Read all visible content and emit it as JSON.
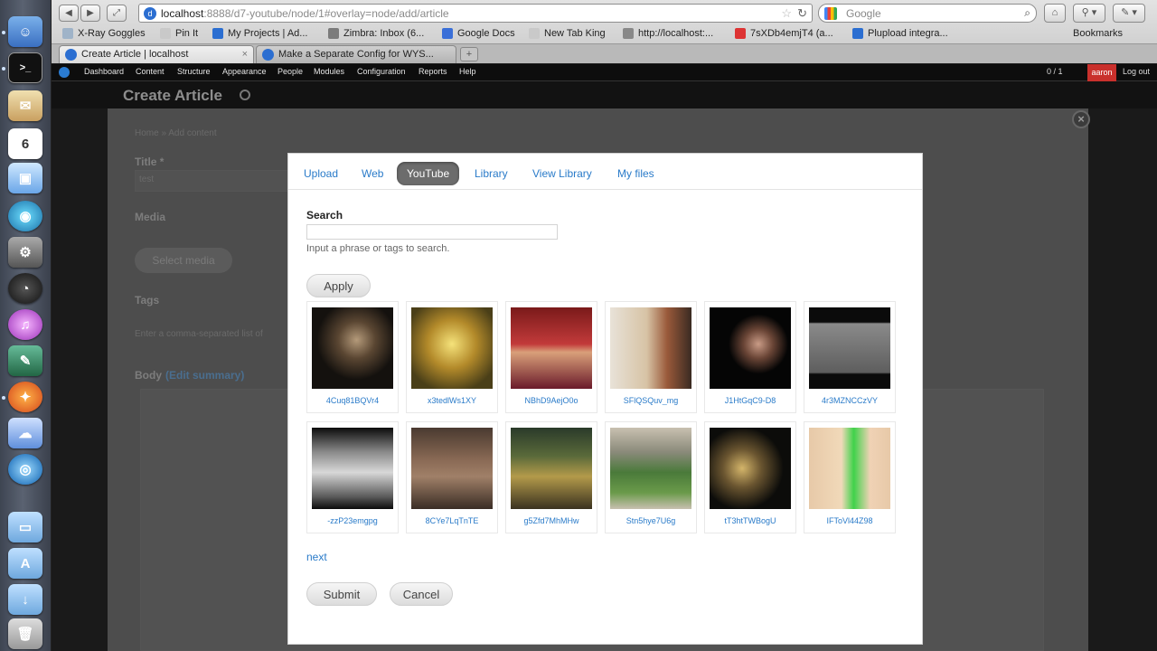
{
  "browser": {
    "url_host": "localhost",
    "url_rest": ":8888/d7-youtube/node/1#overlay=node/add/article",
    "search_placeholder": "Google",
    "bookmarks_label": "Bookmarks",
    "bookmarks": [
      {
        "label": "X-Ray Goggles",
        "color": "#9fb3c8"
      },
      {
        "label": "Pin It",
        "color": "#c9c9c9"
      },
      {
        "label": "My Projects | Ad...",
        "color": "#2b6ed1"
      },
      {
        "label": "Zimbra: Inbox (6...",
        "color": "#7b7b7b"
      },
      {
        "label": "Google Docs",
        "color": "#3a6fd8"
      },
      {
        "label": "New Tab King",
        "color": "#c9c9c9"
      },
      {
        "label": "http://localhost:...",
        "color": "#888888"
      },
      {
        "label": "7sXDb4emjT4 (a...",
        "color": "#d33"
      },
      {
        "label": "Plupload integra...",
        "color": "#2b6ed1"
      }
    ],
    "tabs": [
      {
        "label": "Create Article | localhost",
        "active": true
      },
      {
        "label": "Make a Separate Config for WYS...",
        "active": false
      }
    ]
  },
  "toolbar": {
    "items": [
      "Dashboard",
      "Content",
      "Structure",
      "Appearance",
      "People",
      "Modules",
      "Configuration",
      "Reports",
      "Help"
    ],
    "count": "0 / 1",
    "user": "aaron",
    "logout": "Log out"
  },
  "page": {
    "title": "Create Article",
    "breadcrumb": "Home » Add content",
    "title_field_label": "Title *",
    "title_field_value": "test",
    "media_label": "Media",
    "select_media": "Select media",
    "tags_label": "Tags",
    "tags_help": "Enter a comma-separated list of",
    "body_label": "Body",
    "edit_summary": "(Edit summary)"
  },
  "modal": {
    "tabs": [
      {
        "label": "Upload",
        "active": false
      },
      {
        "label": "Web",
        "active": false
      },
      {
        "label": "YouTube",
        "active": true
      },
      {
        "label": "Library",
        "active": false
      },
      {
        "label": "View Library",
        "active": false
      },
      {
        "label": "My files",
        "active": false
      }
    ],
    "search_label": "Search",
    "search_value": "",
    "search_help": "Input a phrase or tags to search.",
    "apply_label": "Apply",
    "videos": [
      "4Cuq81BQVr4",
      "x3tedlWs1XY",
      "NBhD9AejO0o",
      "SFlQSQuv_mg",
      "J1HtGqC9-D8",
      "4r3MZNCCzVY",
      "-zzP23emgpg",
      "8CYe7LqTnTE",
      "g5Zfd7MhMHw",
      "Stn5hye7U6g",
      "tT3htTWBogU",
      "IFToVl44Z98"
    ],
    "next_label": "next",
    "submit_label": "Submit",
    "cancel_label": "Cancel"
  }
}
